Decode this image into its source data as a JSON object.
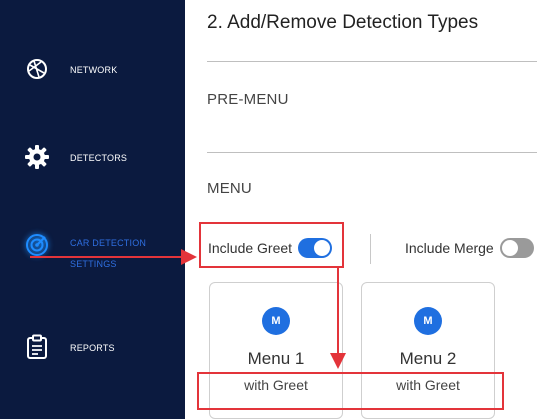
{
  "sidebar": {
    "items": [
      {
        "label": "NETWORK",
        "icon": "network-icon",
        "active": false
      },
      {
        "label": "DETECTORS",
        "icon": "gear-icon",
        "active": false
      },
      {
        "label_line1": "CAR DETECTION",
        "label_line2": "SETTINGS",
        "icon": "radar-icon",
        "active": true
      },
      {
        "label": "REPORTS",
        "icon": "clipboard-icon",
        "active": false
      }
    ]
  },
  "main": {
    "title": "2. Add/Remove Detection Types",
    "pre_menu_heading": "PRE-MENU",
    "menu_heading": "MENU",
    "toggles": [
      {
        "label": "Include Greet",
        "state": "on"
      },
      {
        "label": "Include Merge",
        "state": "off"
      }
    ],
    "cards": [
      {
        "badge": "M",
        "title": "Menu 1",
        "subtitle": "with Greet"
      },
      {
        "badge": "M",
        "title": "Menu 2",
        "subtitle": "with Greet"
      }
    ]
  },
  "colors": {
    "sidebar_bg": "#0b1a3f",
    "accent": "#1f6fe0",
    "annotation": "#e3343a",
    "toggle_off": "#9a9a9a"
  }
}
